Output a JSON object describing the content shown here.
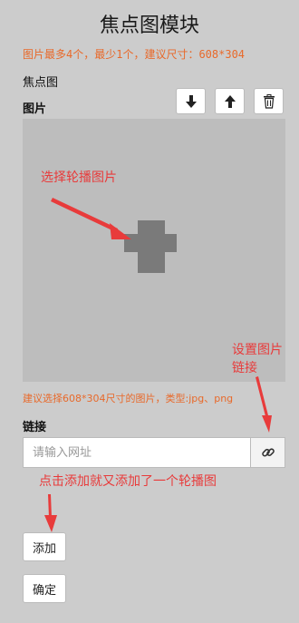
{
  "page": {
    "title": "焦点图模块",
    "hint_top": "图片最多4个，最少1个，建议尺寸：608*304"
  },
  "section": {
    "focus_label": "焦点图",
    "image_label": "图片"
  },
  "toolbar": {
    "move_down_icon": "arrow-down-icon",
    "move_up_icon": "arrow-up-icon",
    "delete_icon": "trash-icon"
  },
  "upload": {
    "icon": "plus-icon",
    "hint": "建议选择608*304尺寸的图片，类型:jpg、png"
  },
  "link": {
    "label": "链接",
    "placeholder": "请输入网址",
    "icon": "link-icon"
  },
  "buttons": {
    "add": "添加",
    "confirm": "确定"
  },
  "annotations": {
    "select_image": "选择轮播图片",
    "set_link_1": "设置图片",
    "set_link_2": "链接",
    "add_note": "点击添加就又添加了一个轮播图"
  },
  "colors": {
    "background": "#cccccc",
    "hint": "#e8692a",
    "annotation": "#e83b3b"
  }
}
